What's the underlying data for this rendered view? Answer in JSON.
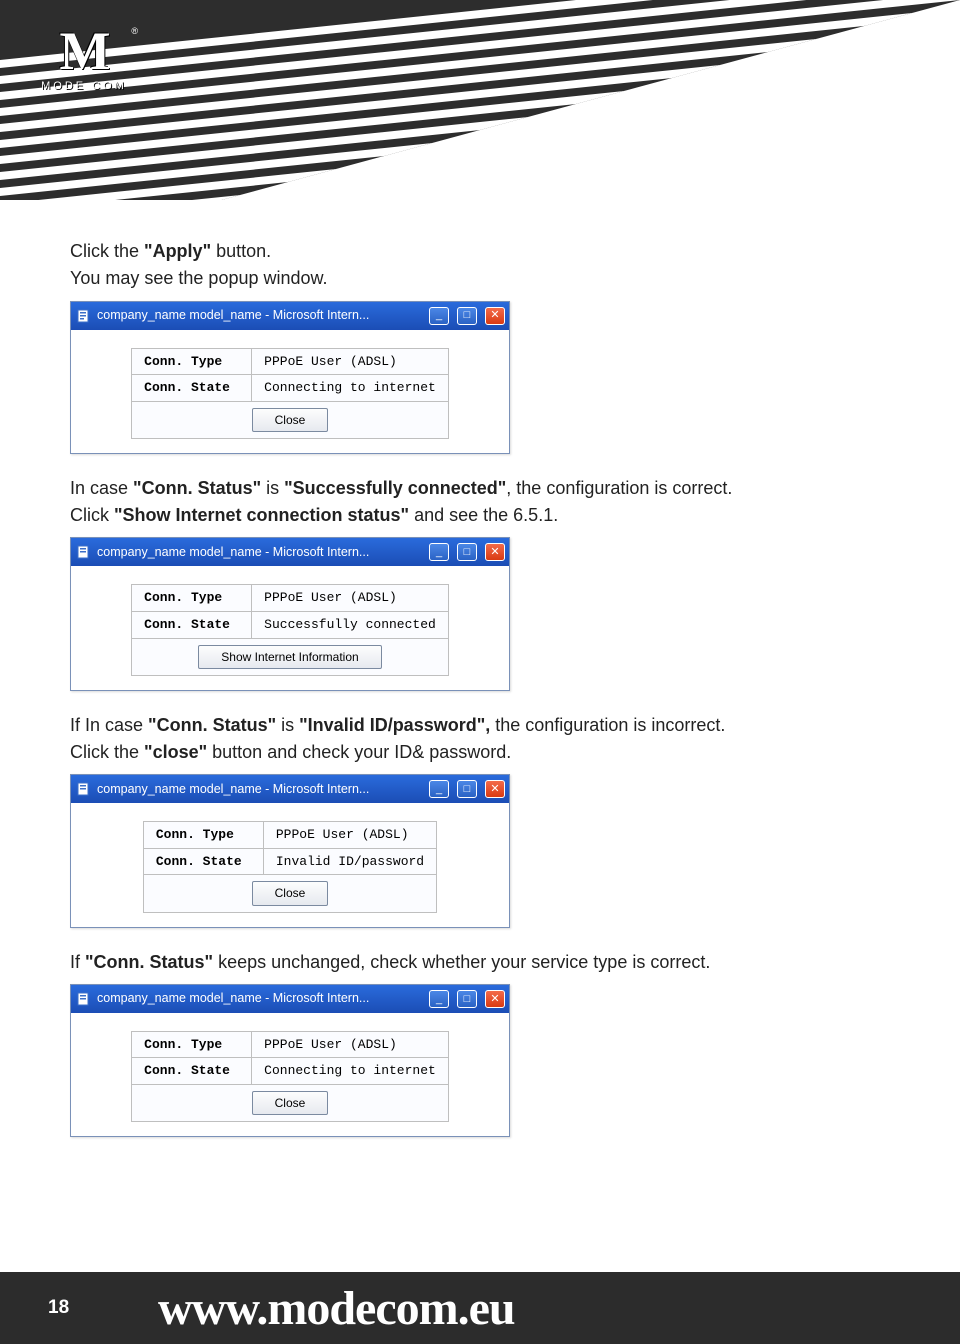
{
  "logo": {
    "mark": "M",
    "name": "MODE COM",
    "reg": "®"
  },
  "text": {
    "p1a": "Click the ",
    "p1b": "\"Apply\"",
    "p1c": " button.",
    "p2": "You may see the popup window.",
    "p3a": "In case ",
    "p3b": "\"Conn. Status\"",
    "p3c": " is ",
    "p3d": "\"Successfully connected\"",
    "p3e": ", the configuration is correct.",
    "p4a": "Click ",
    "p4b": "\"Show Internet connection status\"",
    "p4c": " and see the 6.5.1.",
    "p5a": "If In case ",
    "p5b": "\"Conn. Status\"",
    "p5c": " is ",
    "p5d": "\"Invalid ID/password\",",
    "p5e": " the configuration is incorrect.",
    "p6a": "Click the ",
    "p6b": "\"close\"",
    "p6c": " button and check your ID& password.",
    "p7a": "If ",
    "p7b": "\"Conn. Status\"",
    "p7c": " keeps unchanged, check whether your service type is correct."
  },
  "popup": {
    "title": "company_name model_name - Microsoft Intern...",
    "labels": {
      "type": "Conn. Type",
      "state": "Conn. State"
    },
    "type_value": "PPPoE User (ADSL)",
    "state_connecting": "Connecting to internet",
    "state_success": "Successfully connected",
    "state_invalid": "Invalid ID/password",
    "btn_close": "Close",
    "btn_showinfo": "Show Internet Information"
  },
  "footer": {
    "page": "18",
    "url": "www.modecom.eu"
  }
}
